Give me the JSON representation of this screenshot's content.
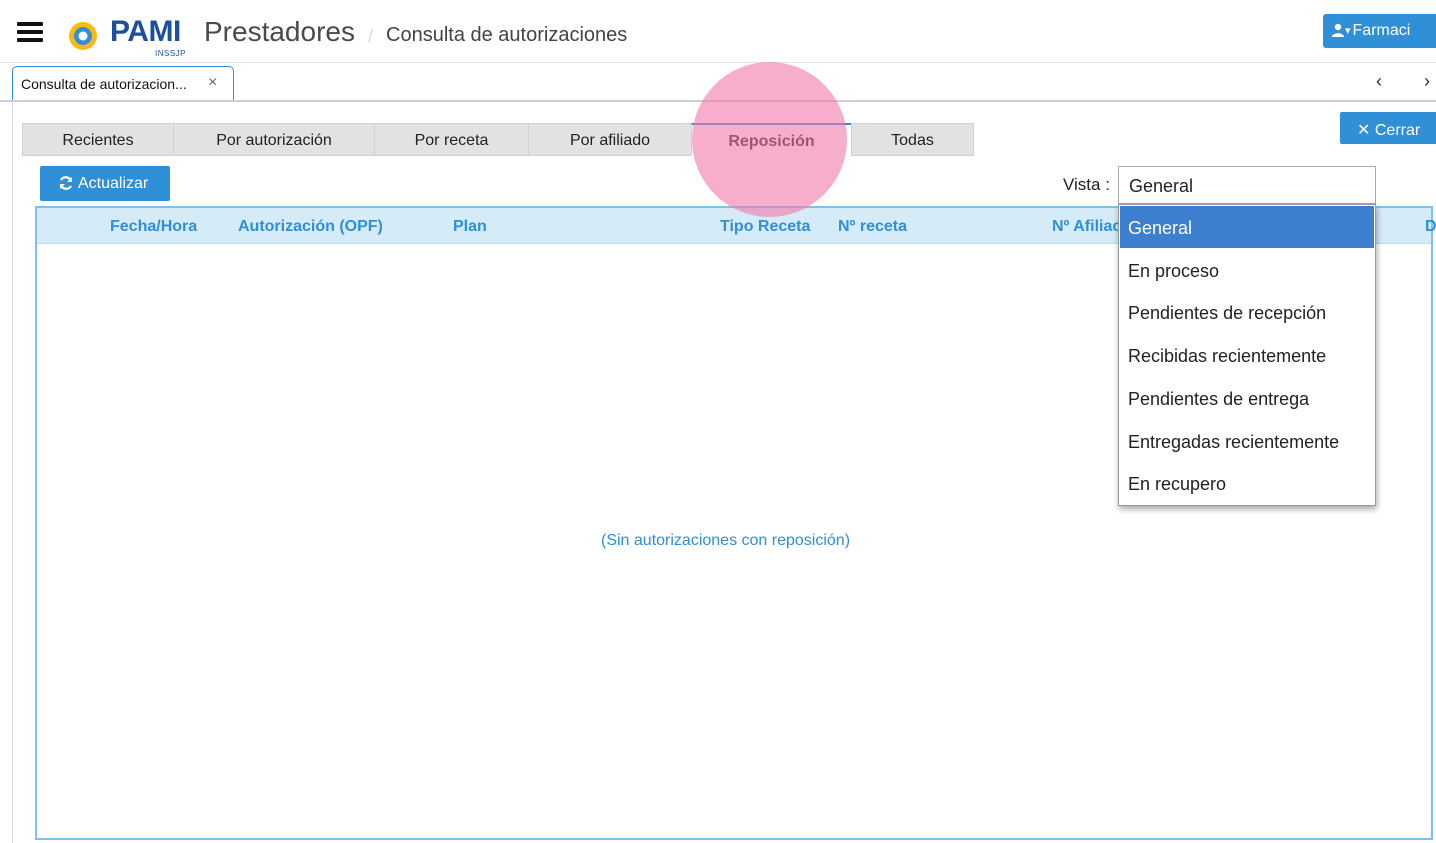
{
  "header": {
    "brand": "PAMI",
    "brand_sub": "INSSJP",
    "app_name": "Prestadores",
    "breadcrumb_sep": "/",
    "breadcrumb": "Consulta de autorizaciones",
    "user_button": "Farmaci"
  },
  "doc_tabs": {
    "active_label": "Consulta de autorizacion...",
    "close": "×",
    "prev": "‹",
    "next": "›"
  },
  "cerrar_label": "Cerrar",
  "filter_tabs": [
    {
      "label": "Recientes"
    },
    {
      "label": "Por autorización"
    },
    {
      "label": "Por receta"
    },
    {
      "label": "Por afiliado"
    },
    {
      "label": "Reposición",
      "active": true
    },
    {
      "label": "Todas"
    }
  ],
  "toolbar": {
    "refresh_label": "Actualizar",
    "vista_label": "Vista :",
    "vista_value": "General"
  },
  "grid": {
    "columns": [
      "Fecha/Hora",
      "Autorización (OPF)",
      "Plan",
      "Tipo Receta",
      "Nº receta",
      "Nº Afiliac",
      "D"
    ],
    "empty_message": "(Sin autorizaciones con reposición)"
  },
  "vista_options": [
    "General",
    "En proceso",
    "Pendientes de recepción",
    "Recibidas recientemente",
    "Pendientes de entrega",
    "Entregadas recientemente",
    "En recupero"
  ],
  "colors": {
    "accent": "#2f8fd7",
    "brand": "#1c4f9c",
    "selected_option": "#3c7fcf",
    "grid_header": "#d5ebf8"
  }
}
